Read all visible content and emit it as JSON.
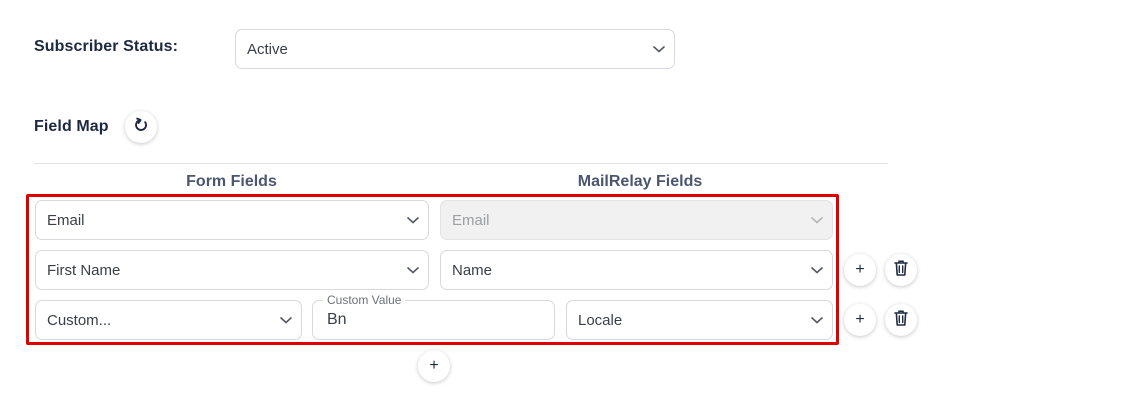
{
  "subscriber_status": {
    "label": "Subscriber Status:",
    "selected": "Active"
  },
  "field_map": {
    "title": "Field Map",
    "refresh_icon": "refresh-icon",
    "headers": {
      "form_fields": "Form Fields",
      "mailrelay_fields": "MailRelay Fields"
    },
    "rows": [
      {
        "form_field": "Email",
        "mailrelay_field": "Email",
        "mailrelay_disabled": true
      },
      {
        "form_field": "First Name",
        "mailrelay_field": "Name"
      },
      {
        "form_field": "Custom...",
        "custom_value_label": "Custom Value",
        "custom_value": "Bn",
        "mailrelay_field": "Locale"
      }
    ],
    "add_label": "+",
    "add_row_label": "+"
  },
  "colors": {
    "highlight": "#e00000",
    "text_dark": "#1d2943"
  }
}
